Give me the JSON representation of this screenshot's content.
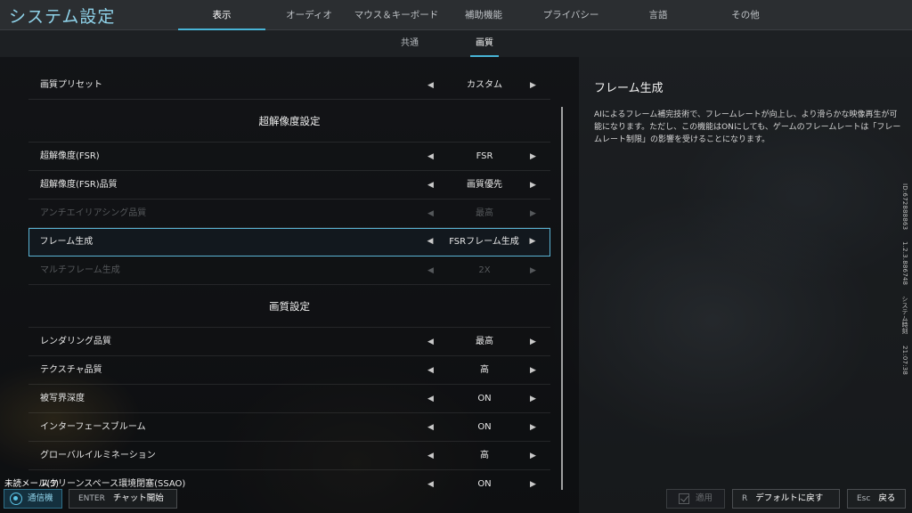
{
  "app_title": "システム設定",
  "main_tabs": [
    {
      "label": "表示",
      "active": true
    },
    {
      "label": "オーディオ",
      "active": false
    },
    {
      "label": "マウス＆キーボード",
      "active": false
    },
    {
      "label": "補助機能",
      "active": false
    },
    {
      "label": "プライバシー",
      "active": false
    },
    {
      "label": "言語",
      "active": false
    },
    {
      "label": "その他",
      "active": false
    }
  ],
  "sub_tabs": [
    {
      "label": "共通",
      "active": false
    },
    {
      "label": "画質",
      "active": true
    }
  ],
  "arrows": {
    "left": "◀",
    "right": "▶"
  },
  "settings": {
    "preset": {
      "label": "画質プリセット",
      "value": "カスタム"
    },
    "section_upscale": "超解像度設定",
    "upscale_rows": [
      {
        "label": "超解像度(FSR)",
        "value": "FSR",
        "state": "normal"
      },
      {
        "label": "超解像度(FSR)品質",
        "value": "画質優先",
        "state": "normal"
      },
      {
        "label": "アンチエイリアシング品質",
        "value": "最高",
        "state": "disabled"
      },
      {
        "label": "フレーム生成",
        "value": "FSRフレーム生成",
        "state": "selected"
      },
      {
        "label": "マルチフレーム生成",
        "value": "2X",
        "state": "disabled"
      }
    ],
    "section_quality": "画質設定",
    "quality_rows": [
      {
        "label": "レンダリング品質",
        "value": "最高",
        "state": "normal"
      },
      {
        "label": "テクスチャ品質",
        "value": "高",
        "state": "normal"
      },
      {
        "label": "被写界深度",
        "value": "ON",
        "state": "normal"
      },
      {
        "label": "インターフェースブルーム",
        "value": "ON",
        "state": "normal"
      },
      {
        "label": "グローバルイルミネーション",
        "value": "高",
        "state": "normal"
      },
      {
        "label": "スクリーンスペース環境閉塞(SSAO)",
        "value": "ON",
        "state": "normal"
      }
    ]
  },
  "description": {
    "title": "フレーム生成",
    "text": "AIによるフレーム補完技術で、フレームレートが向上し、より滑らかな映像再生が可能になります。ただし、この機能はONにしても、ゲームのフレームレートは「フレームレート制限」の影響を受けることになります。"
  },
  "side_meta": {
    "id": "ID:672888863",
    "version": "1.2.3.886748",
    "label": "システム時刻",
    "time": "21:07:38"
  },
  "bottom": {
    "unread": "未読メール(3)",
    "comm_label": "通信機",
    "chat_key": "ENTER",
    "chat_label": "チャット開始",
    "apply_label": "適用",
    "default_key": "R",
    "default_label": "デフォルトに戻す",
    "back_key": "Esc",
    "back_label": "戻る"
  },
  "colors": {
    "accent": "#48b4d6",
    "selected_border": "#5ab3d4",
    "title": "#8fd3ea"
  }
}
